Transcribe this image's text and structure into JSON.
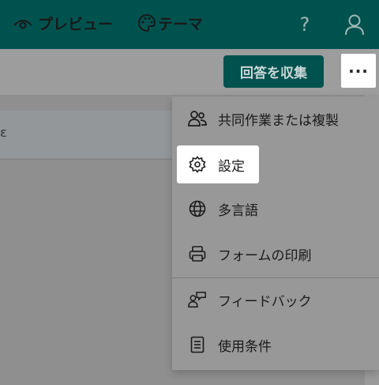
{
  "header": {
    "help_label": "?",
    "help_icon": "question-icon",
    "account_icon": "person-icon"
  },
  "toolbar": {
    "preview_label": "プレビュー",
    "preview_icon": "eye-icon",
    "theme_label": "テーマ",
    "theme_icon": "palette-icon",
    "collect_label": "回答を収集",
    "more_label": "···"
  },
  "background": {
    "partial_text": "ε"
  },
  "menu": {
    "items": [
      {
        "label": "共同作業または複製",
        "icon": "people-icon"
      },
      {
        "label": "設定",
        "icon": "gear-icon",
        "highlighted": true
      },
      {
        "label": "多言語",
        "icon": "globe-icon"
      },
      {
        "label": "フォームの印刷",
        "icon": "printer-icon"
      },
      {
        "label": "フィードバック",
        "icon": "person-feedback-icon"
      },
      {
        "label": "使用条件",
        "icon": "document-icon"
      }
    ]
  },
  "colors": {
    "brand": "#00524f",
    "overlay": "#9d9d9d",
    "highlight": "#ffffff"
  }
}
